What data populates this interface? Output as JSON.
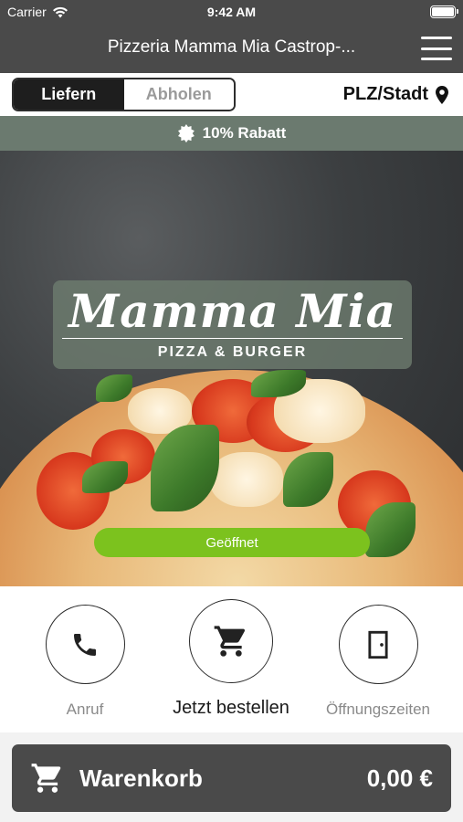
{
  "status_bar": {
    "carrier": "Carrier",
    "time": "9:42 AM"
  },
  "navbar": {
    "title": "Pizzeria Mamma Mia Castrop-..."
  },
  "order_mode": {
    "delivery_label": "Liefern",
    "pickup_label": "Abholen",
    "selected": "Liefern"
  },
  "location": {
    "label": "PLZ/Stadt"
  },
  "promo": {
    "text": "10% Rabatt"
  },
  "hero": {
    "logo_title": "Mamma Mia",
    "logo_subtitle": "PIZZA & BURGER",
    "status": "Geöffnet"
  },
  "actions": {
    "call_label": "Anruf",
    "order_label": "Jetzt bestellen",
    "hours_label": "Öffnungszeiten"
  },
  "cart": {
    "label": "Warenkorb",
    "total": "0,00 €"
  },
  "colors": {
    "bar": "#4a4a4a",
    "promo": "#6b7a6f",
    "open": "#7cc21e"
  },
  "icons": [
    "wifi-icon",
    "battery-icon",
    "menu-icon",
    "location-pin-icon",
    "badge-icon",
    "phone-icon",
    "cart-icon",
    "door-icon"
  ]
}
